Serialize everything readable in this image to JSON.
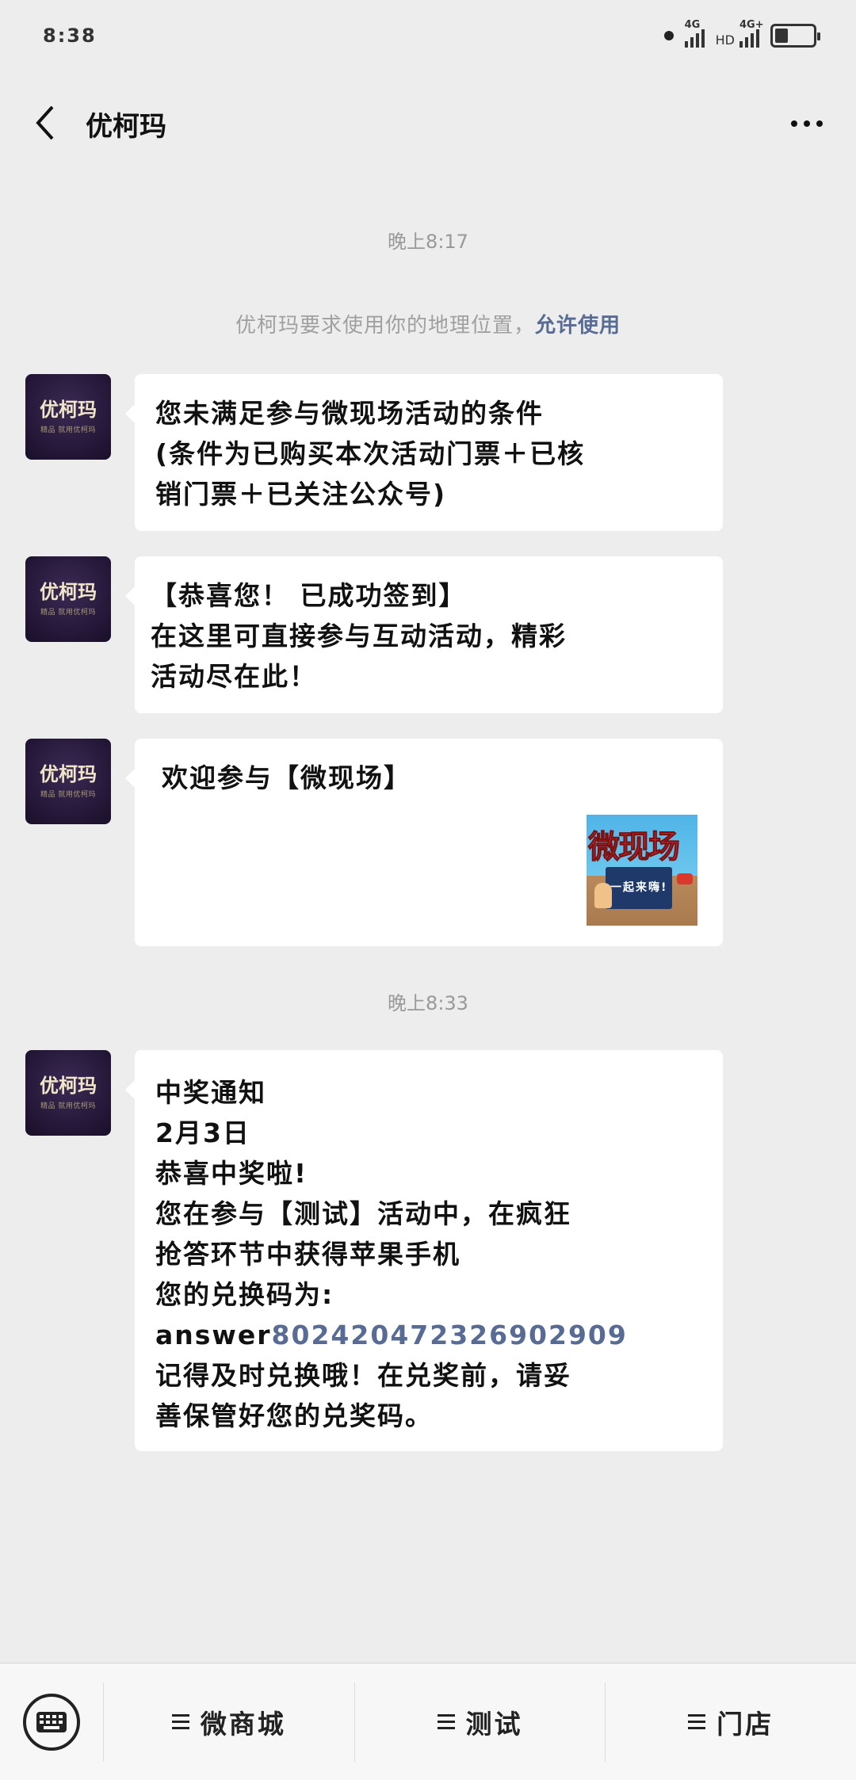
{
  "status_bar": {
    "time": "8:38",
    "signal1_label": "4G",
    "signal2_label": "4G+",
    "hd_label": "HD",
    "battery_fraction": 0.35
  },
  "header": {
    "title": "优柯玛"
  },
  "chat": {
    "time_1": "晚上8:17",
    "system_message": {
      "text": "优柯玛要求使用你的地理位置，",
      "action": "允许使用"
    },
    "avatar": {
      "title": "优柯玛",
      "subtitle": "精品 就用优柯玛"
    },
    "msg_1": {
      "lines": [
        "您未满足参与微现场活动的条件",
        "(条件为已购买本次活动门票＋已核",
        "销门票＋已关注公众号)"
      ]
    },
    "msg_2": {
      "lines": [
        "【恭喜您！ 已成功签到】",
        "在这里可直接参与互动活动，精彩",
        "活动尽在此！"
      ]
    },
    "msg_3": {
      "title": "欢迎参与【微现场】",
      "thumb_title": "微现场",
      "thumb_subtitle": "一起来嗨!"
    },
    "time_2": "晚上8:33",
    "msg_4": {
      "lines": [
        "中奖通知",
        "2月3日",
        "恭喜中奖啦!",
        "您在参与【测试】活动中，在疯狂",
        "抢答环节中获得苹果手机",
        "您的兑换码为:"
      ],
      "code_prefix": "answer",
      "code_number": "80242047232690290​9",
      "after_lines": [
        "记得及时兑换哦！在兑奖前，请妥",
        "善保管好您的兑奖码。"
      ]
    }
  },
  "bottom_menu": {
    "items": [
      "微商城",
      "测试",
      "门店"
    ]
  },
  "colors": {
    "link": "#576b95",
    "background": "#ededed"
  }
}
